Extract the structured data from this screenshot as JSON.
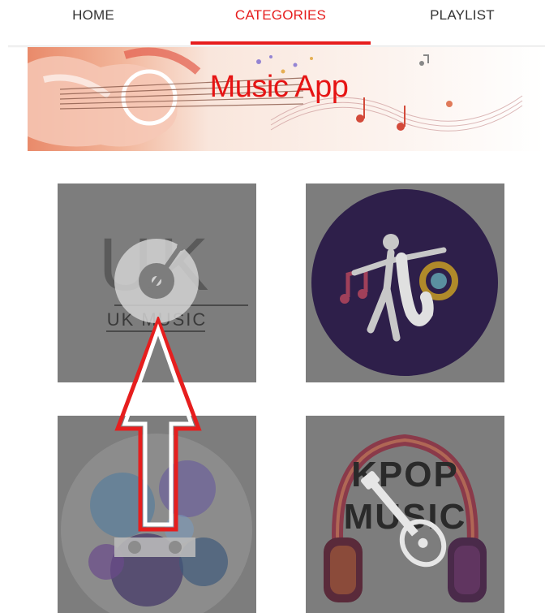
{
  "tabs": {
    "home": "HOME",
    "categories": "CATEGORIES",
    "playlist": "PLAYLIST",
    "active": "categories"
  },
  "banner": {
    "title": "Music App"
  },
  "categories": [
    {
      "icon": "vinyl-record-icon",
      "logo_letters": "UK",
      "logo_word": "UK MUSIC"
    },
    {
      "icon": "saxophone-icon"
    },
    {
      "icon": "mixing-deck-icon"
    },
    {
      "icon": "guitar-icon",
      "logo_line1": "KPOP",
      "logo_line2": "MUSIC"
    }
  ],
  "colors": {
    "accent": "#e61e1e",
    "tile_overlay": "#7d7d7d",
    "arrow": "#e61e1e"
  }
}
